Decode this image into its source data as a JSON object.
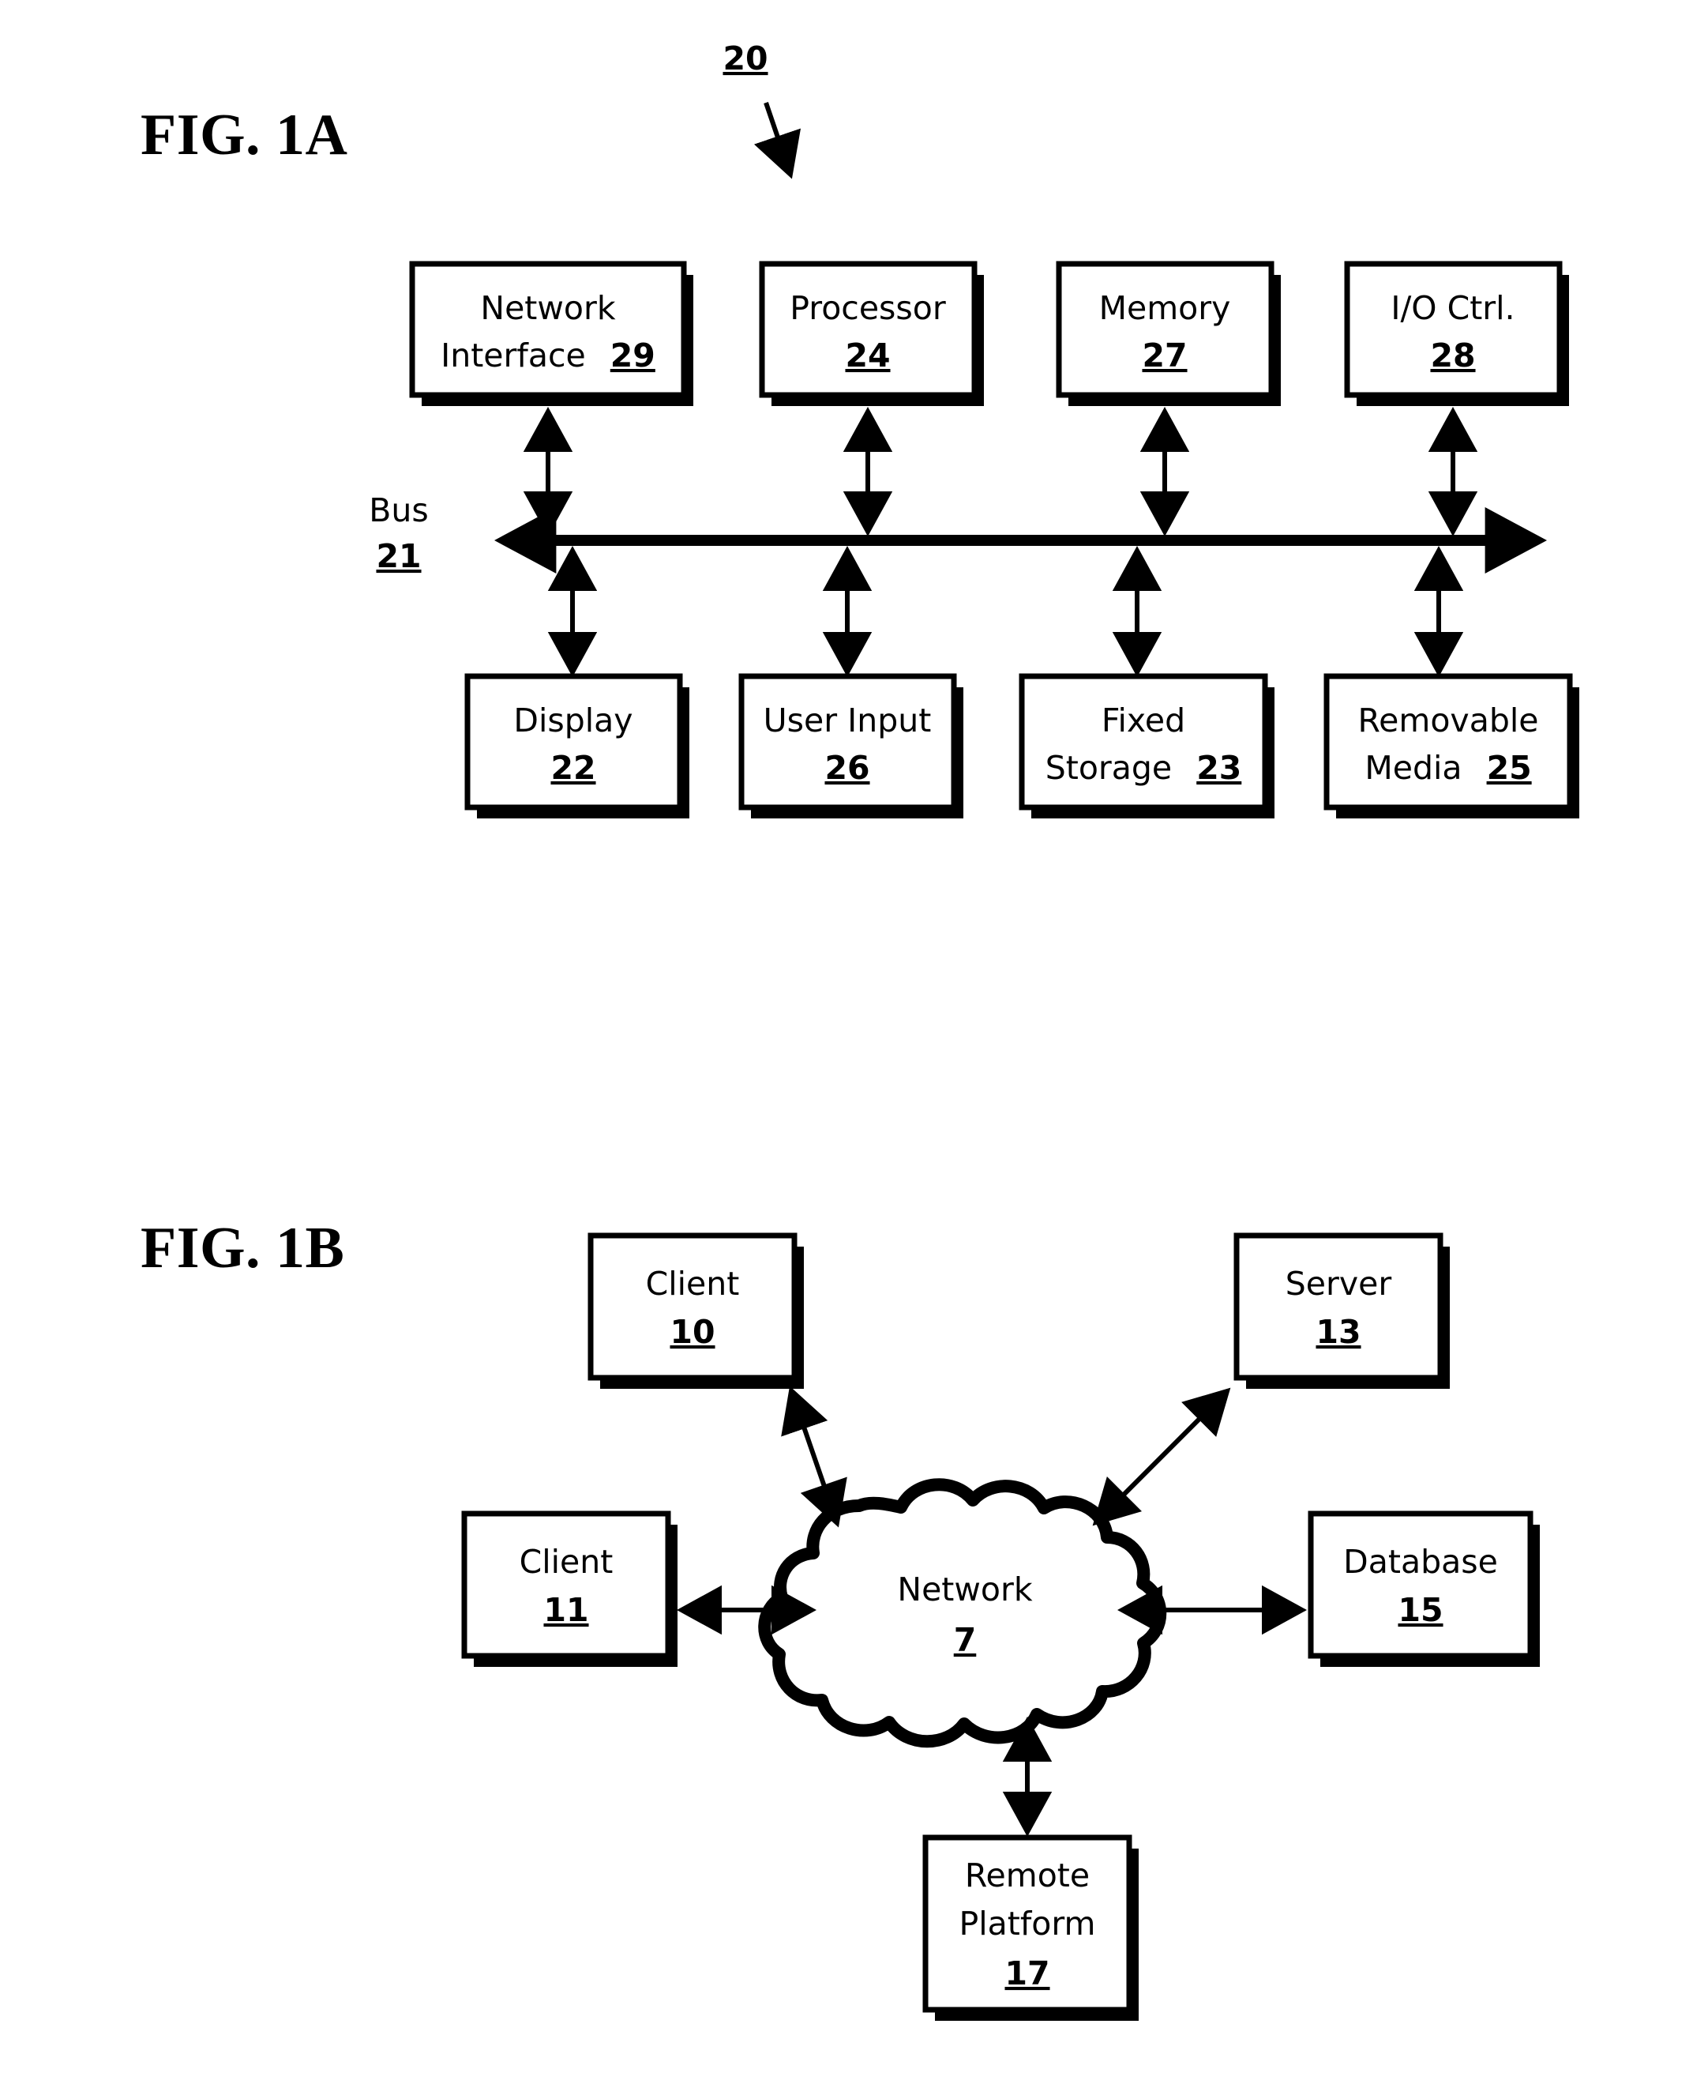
{
  "figures": [
    {
      "id": "fig-1a",
      "title": "FIG. 1A",
      "callout": {
        "label": "20"
      },
      "bus": {
        "label": "Bus",
        "ref": "21"
      },
      "top_row": [
        {
          "name": "network-interface",
          "line1": "Network",
          "line2": "Interface",
          "ref": "29",
          "inline": true
        },
        {
          "name": "processor",
          "line1": "Processor",
          "line2": "",
          "ref": "24",
          "inline": false
        },
        {
          "name": "memory",
          "line1": "Memory",
          "line2": "",
          "ref": "27",
          "inline": false
        },
        {
          "name": "io-controller",
          "line1": "I/O Ctrl.",
          "line2": "",
          "ref": "28",
          "inline": false
        }
      ],
      "bottom_row": [
        {
          "name": "display",
          "line1": "Display",
          "line2": "",
          "ref": "22",
          "inline": false
        },
        {
          "name": "user-input",
          "line1": "User Input",
          "line2": "",
          "ref": "26",
          "inline": false
        },
        {
          "name": "fixed-storage",
          "line1": "Fixed",
          "line2": "Storage",
          "ref": "23",
          "inline": true
        },
        {
          "name": "removable-media",
          "line1": "Removable",
          "line2": "Media",
          "ref": "25",
          "inline": true
        }
      ]
    },
    {
      "id": "fig-1b",
      "title": "FIG. 1B",
      "cloud": {
        "label": "Network",
        "ref": "7"
      },
      "nodes": [
        {
          "name": "client-10",
          "line1": "Client",
          "line2": "",
          "line3": "",
          "ref": "10"
        },
        {
          "name": "server-13",
          "line1": "Server",
          "line2": "",
          "line3": "",
          "ref": "13"
        },
        {
          "name": "client-11",
          "line1": "Client",
          "line2": "",
          "line3": "",
          "ref": "11"
        },
        {
          "name": "database-15",
          "line1": "Database",
          "line2": "",
          "line3": "",
          "ref": "15"
        },
        {
          "name": "remote-platform-17",
          "line1": "Remote",
          "line2": "Platform",
          "line3": "",
          "ref": "17"
        }
      ]
    }
  ],
  "colors": {
    "ink": "#000000",
    "paper": "#ffffff"
  }
}
